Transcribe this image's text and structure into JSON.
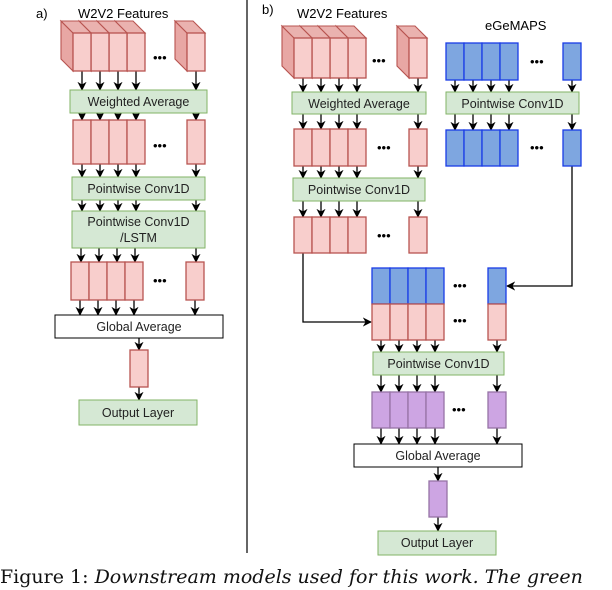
{
  "panel_a": {
    "label": "a)",
    "input_title": "W2V2 Features",
    "layers": [
      "Weighted Average",
      "Pointwise Conv1D",
      "Pointwise Conv1D",
      "/LSTM",
      "Global Average",
      "Output Layer"
    ],
    "ellipsis": "•••"
  },
  "panel_b": {
    "label": "b)",
    "input_title": "W2V2 Features",
    "egemaps_title": "eGeMAPS",
    "w2v2_layers": [
      "Weighted Average",
      "Pointwise Conv1D"
    ],
    "egemaps_layers": [
      "Pointwise Conv1D"
    ],
    "fused_layers": [
      "Pointwise Conv1D",
      "Global Average",
      "Output Layer"
    ],
    "ellipsis": "•••"
  },
  "colors": {
    "w2v2_fill": "#f8cecc",
    "w2v2_stroke": "#b85450",
    "egemaps_fill": "#7ea6e0",
    "egemaps_stroke": "#1a3ce6",
    "fused_fill": "#cda5e3",
    "fused_stroke": "#9673a6",
    "layer_fill": "#d5e8d4",
    "layer_stroke": "#82b366"
  },
  "caption": {
    "prefix": "Figure 1:",
    "text": "Downstream models used for this work. The green"
  }
}
